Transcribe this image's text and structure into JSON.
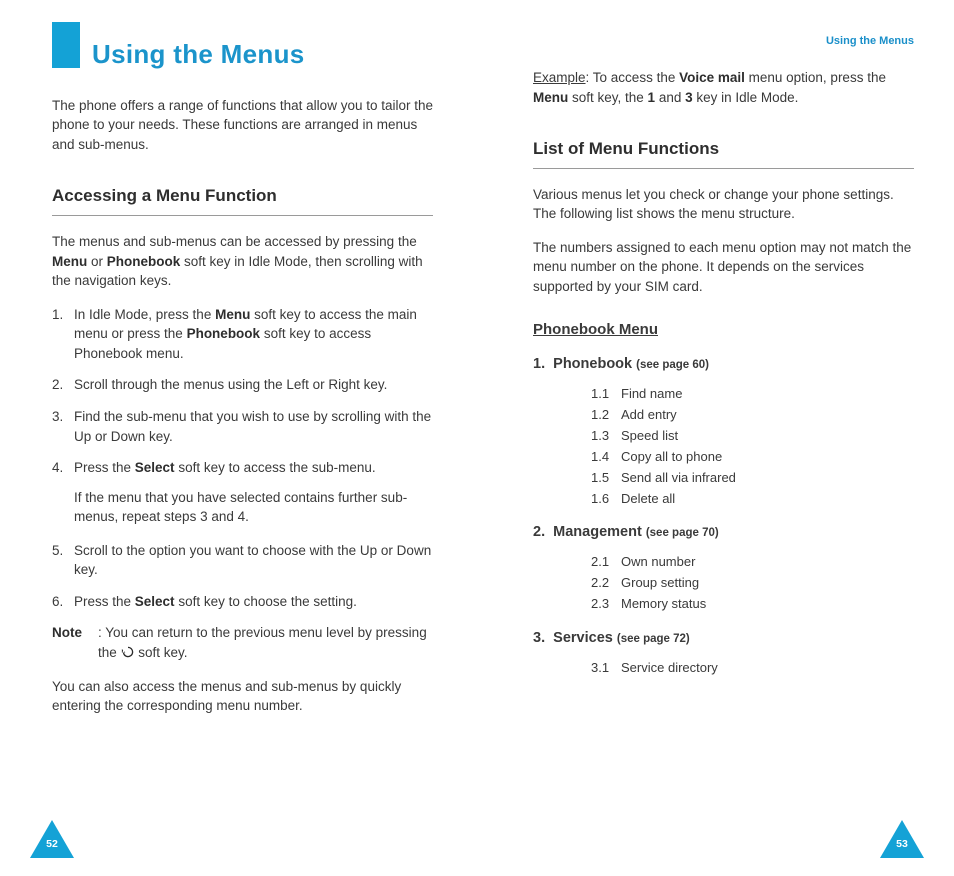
{
  "runningHead": "Using the Menus",
  "title": "Using the Menus",
  "intro": "The phone offers a range of functions that allow you to tailor the phone to your needs. These functions are arranged in menus and sub-menus.",
  "sectionA": {
    "heading": "Accessing a Menu Function",
    "lead_pre": "The menus and sub-menus can be accessed by pressing the ",
    "lead_b1": "Menu",
    "lead_mid1": " or ",
    "lead_b2": "Phonebook",
    "lead_post": " soft key in Idle Mode, then scrolling with the navigation keys.",
    "steps": {
      "s1_pre": "In Idle Mode, press the ",
      "s1_b1": "Menu",
      "s1_mid": " soft key to access the main menu or press the ",
      "s1_b2": "Phonebook",
      "s1_post": " soft key to access Phonebook menu.",
      "s2": "Scroll through the menus using the Left or Right key.",
      "s3": "Find the sub-menu that you wish to use by scrolling with the Up or Down key.",
      "s4_pre": "Press the ",
      "s4_b": "Select",
      "s4_post": " soft key to access the sub-menu.",
      "s4_extra": "If the menu that you have selected contains further sub-menus, repeat steps 3 and 4.",
      "s5": "Scroll to the option you want to choose with the Up or Down key.",
      "s6_pre": "Press the ",
      "s6_b": "Select",
      "s6_post": " soft key to choose the setting."
    },
    "note_label": "Note",
    "note_pre": ": You can return to the previous menu level by pressing the ",
    "note_post": " soft key.",
    "tail": "You can also access the menus and sub-menus by quickly entering the corresponding menu number."
  },
  "example": {
    "label": "Example",
    "pre": ": To access the ",
    "b1": "Voice mail",
    "mid1": " menu option, press the ",
    "b2": "Menu",
    "mid2": " soft key, the ",
    "b3": "1",
    "mid3": " and ",
    "b4": "3",
    "post": " key in Idle Mode."
  },
  "sectionB": {
    "heading": "List of Menu Functions",
    "p1": "Various menus let you check or change your phone settings. The following list shows the menu structure.",
    "p2": "The numbers assigned to each menu option may not match the menu number on the phone. It depends on the services supported by your SIM card.",
    "subheading": "Phonebook Menu",
    "m1": {
      "num": "1.",
      "name": "Phonebook",
      "see": "(see page 60)",
      "items": [
        {
          "n": "1.1",
          "t": "Find name"
        },
        {
          "n": "1.2",
          "t": "Add entry"
        },
        {
          "n": "1.3",
          "t": "Speed list"
        },
        {
          "n": "1.4",
          "t": "Copy all to phone"
        },
        {
          "n": "1.5",
          "t": "Send all via infrared"
        },
        {
          "n": "1.6",
          "t": "Delete all"
        }
      ]
    },
    "m2": {
      "num": "2.",
      "name": "Management",
      "see": "(see page 70)",
      "items": [
        {
          "n": "2.1",
          "t": "Own number"
        },
        {
          "n": "2.2",
          "t": "Group setting"
        },
        {
          "n": "2.3",
          "t": "Memory status"
        }
      ]
    },
    "m3": {
      "num": "3.",
      "name": "Services",
      "see": "(see page 72)",
      "items": [
        {
          "n": "3.1",
          "t": "Service directory"
        }
      ]
    }
  },
  "pageNumbers": {
    "left": "52",
    "right": "53"
  }
}
